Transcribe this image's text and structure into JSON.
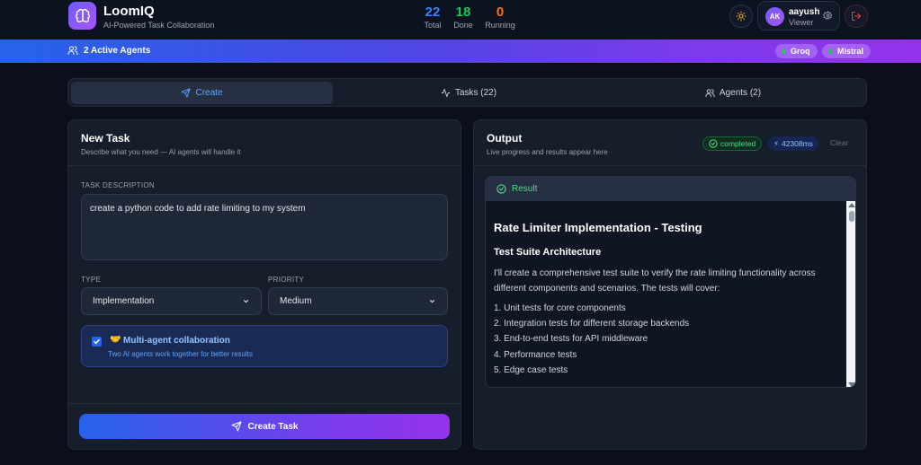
{
  "header": {
    "brand_title": "LoomIQ",
    "brand_subtitle": "AI-Powered Task Collaboration",
    "stats": [
      {
        "value": "22",
        "label": "Total",
        "color": "#3b82f6"
      },
      {
        "value": "18",
        "label": "Done",
        "color": "#22c55e"
      },
      {
        "value": "0",
        "label": "Running",
        "color": "#f97316"
      }
    ],
    "user": {
      "initials": "AK",
      "name": "aayush",
      "role": "Viewer"
    },
    "icons": {
      "logo": "brain-icon",
      "theme": "sun-icon",
      "settings": "gear-icon",
      "logout": "logout-icon"
    }
  },
  "agent_bar": {
    "active_label": "2 Active Agents",
    "agents": [
      "Groq",
      "Mistral"
    ]
  },
  "tabs": [
    {
      "label": "Create",
      "icon": "send-icon",
      "active": true
    },
    {
      "label": "Tasks (22)",
      "icon": "activity-icon",
      "active": false
    },
    {
      "label": "Agents (2)",
      "icon": "users-icon",
      "active": false
    }
  ],
  "new_task": {
    "title": "New Task",
    "subtitle": "Describe what you need — AI agents will handle it",
    "description_label": "TASK DESCRIPTION",
    "description_value": "create a python code to add rate limiting to my system",
    "type_label": "TYPE",
    "type_value": "Implementation",
    "priority_label": "PRIORITY",
    "priority_value": "Medium",
    "collab_checked": true,
    "collab_emoji": "🤝",
    "collab_title": "Multi-agent collaboration",
    "collab_subtitle": "Two AI agents work together for better results",
    "create_button": "Create Task"
  },
  "output": {
    "title": "Output",
    "subtitle": "Live progress and results appear here",
    "status": "completed",
    "duration": "42308ms",
    "clear_label": "Clear",
    "result_label": "Result",
    "result": {
      "heading": "Rate Limiter Implementation - Testing",
      "subheading": "Test Suite Architecture",
      "paragraph": "I'll create a comprehensive test suite to verify the rate limiting functionality across different components and scenarios. The tests will cover:",
      "items": [
        "1. Unit tests for core components",
        "2. Integration tests for different storage backends",
        "3. End-to-end tests for API middleware",
        "4. Performance tests",
        "5. Edge case tests"
      ]
    }
  }
}
